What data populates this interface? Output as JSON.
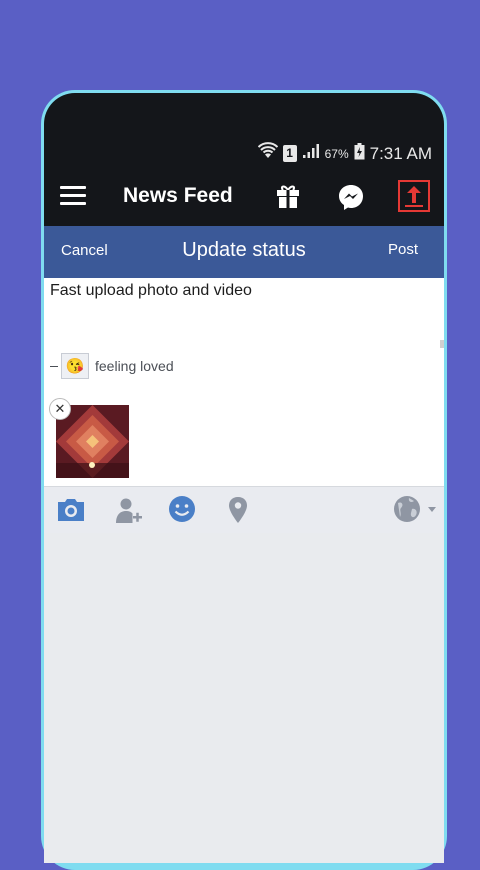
{
  "status_bar": {
    "sim": "1",
    "battery_percent": "67%",
    "time": "7:31 AM"
  },
  "toolbar": {
    "title": "News Feed",
    "icons": [
      "menu-icon",
      "gift-icon",
      "messenger-icon",
      "upload-icon"
    ]
  },
  "compose_header": {
    "cancel_label": "Cancel",
    "title": "Update status",
    "post_label": "Post"
  },
  "compose": {
    "text": "Fast upload photo and video",
    "feeling_text": "feeling loved",
    "feeling_emoji": "😘"
  },
  "action_bar": {
    "icons": [
      "camera-icon",
      "tag-friends-icon",
      "smiley-icon",
      "location-pin-icon",
      "globe-icon"
    ]
  },
  "colors": {
    "background": "#5a5fc5",
    "frame": "#7fdcf0",
    "header_blue": "#3b5998",
    "action_icon": "#4a7fc7"
  }
}
